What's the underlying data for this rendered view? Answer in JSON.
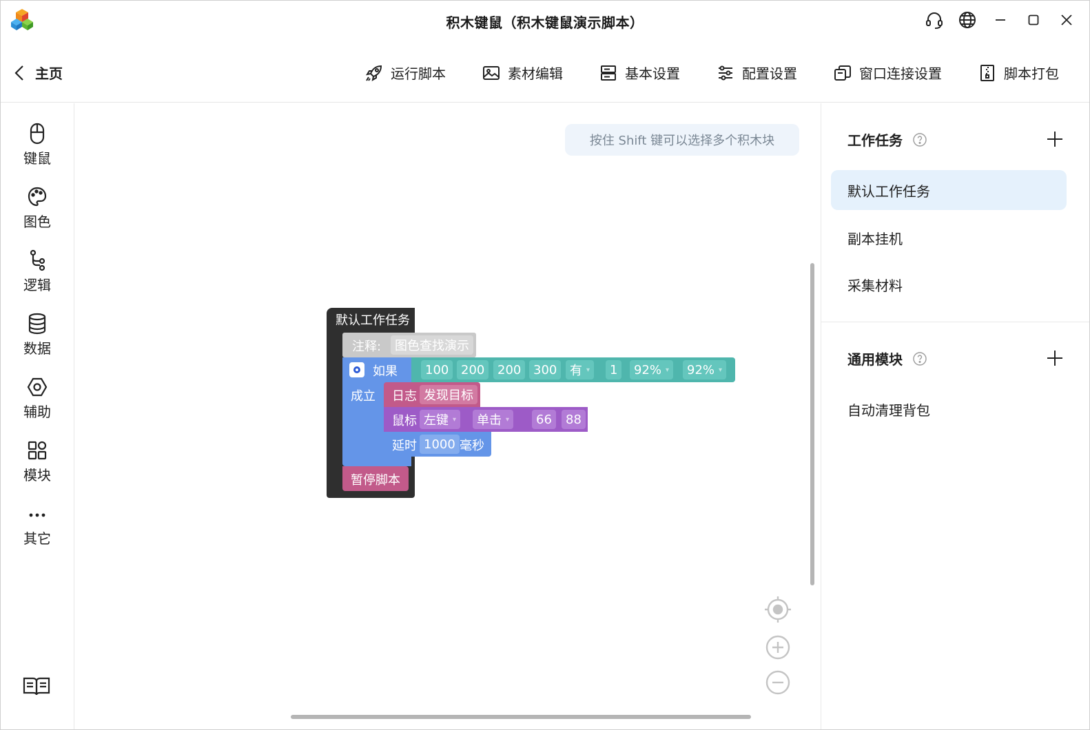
{
  "window": {
    "title": "积木键鼠（积木键鼠演示脚本）"
  },
  "title_controls": [
    "headset-icon",
    "globe-icon",
    "minimize-icon",
    "maximize-icon",
    "close-icon"
  ],
  "toolbar": {
    "home_label": "主页",
    "items": [
      {
        "label": "运行脚本",
        "icon": "rocket-icon"
      },
      {
        "label": "素材编辑",
        "icon": "image-icon"
      },
      {
        "label": "基本设置",
        "icon": "server-icon"
      },
      {
        "label": "配置设置",
        "icon": "sliders-icon"
      },
      {
        "label": "窗口连接设置",
        "icon": "window-link-icon"
      },
      {
        "label": "脚本打包",
        "icon": "zip-icon"
      }
    ]
  },
  "sidebar": {
    "items": [
      {
        "label": "键鼠",
        "icon": "mouse-icon"
      },
      {
        "label": "图色",
        "icon": "palette-icon"
      },
      {
        "label": "逻辑",
        "icon": "branch-icon"
      },
      {
        "label": "数据",
        "icon": "database-icon"
      },
      {
        "label": "辅助",
        "icon": "hex-nut-icon"
      },
      {
        "label": "模块",
        "icon": "grid-icon"
      },
      {
        "label": "其它",
        "icon": "more-icon"
      }
    ],
    "bottom_icon": "book-icon"
  },
  "workspace": {
    "hint": "按住 Shift 键可以选择多个积木块",
    "colors": {
      "hat": "#2f2f2f",
      "comment": "#c9c9c9",
      "logic": "#6495e8",
      "vision": "#4fb6ad",
      "log": "#c25a8a",
      "mouse": "#9d5bc7",
      "pause": "#c25a8a"
    },
    "blocks": {
      "hat_label": "默认工作任务",
      "comment_label": "注释:",
      "comment_value": "图色查找演示",
      "if_label": "如果",
      "if_fields": [
        "100",
        "200",
        "200",
        "300",
        "有",
        "1",
        "92%",
        "92%"
      ],
      "then_label": "成立",
      "log_label": "日志",
      "log_value": "发现目标",
      "mouse_label": "鼠标",
      "mouse_button": "左键",
      "mouse_action": "单击",
      "mouse_x": "66",
      "mouse_y": "88",
      "delay_label": "延时",
      "delay_value": "1000",
      "delay_unit": "毫秒",
      "pause_label": "暂停脚本"
    }
  },
  "right_panel": {
    "tasks_title": "工作任务",
    "tasks": [
      "默认工作任务",
      "副本挂机",
      "采集材料"
    ],
    "active_task": "默认工作任务",
    "modules_title": "通用模块",
    "modules": [
      "自动清理背包"
    ]
  }
}
